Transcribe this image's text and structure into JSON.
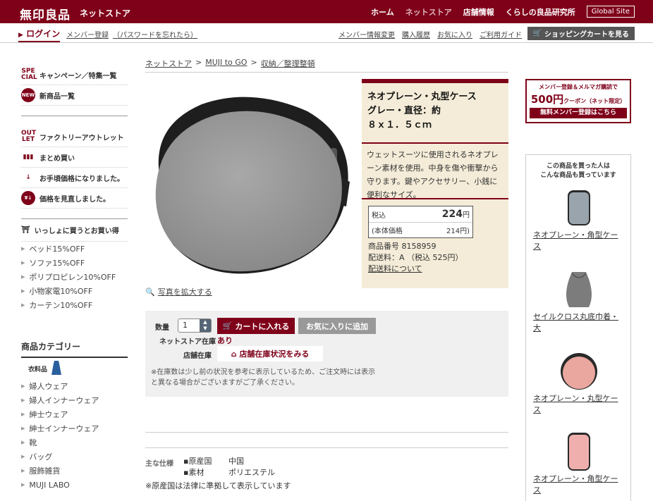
{
  "header": {
    "brand": "無印良品",
    "brand_sub": "ネットストア",
    "nav": [
      "ホーム",
      "ネットストア",
      "店舗情報",
      "くらしの良品研究所"
    ],
    "global": "Global Site"
  },
  "subbar": {
    "login": "ログイン",
    "left_links": [
      "メンバー登録",
      "（パスワードを忘れたら）"
    ],
    "right_links": [
      "メンバー情報変更",
      "購入履歴",
      "お気に入り",
      "ご利用ガイド"
    ],
    "cart": "ショッピングカートを見る"
  },
  "sidebar": {
    "special": {
      "icon": "SPE CIAL",
      "label": "キャンペーン／特集一覧"
    },
    "new_items": {
      "icon": "NEW",
      "label": "新商品一覧"
    },
    "outlet": {
      "icon": "OUT LET",
      "label": "ファクトリーアウトレット"
    },
    "bulk": "まとめ買い",
    "affordable": "お手頃価格になりました。",
    "price_review": "価格を見直しました。",
    "together": "いっしょに買うとお買い得",
    "together_items": [
      "ベッド15%OFF",
      "ソファ15%OFF",
      "ポリプロピレン10%OFF",
      "小物家電10%OFF",
      "カーテン10%OFF"
    ],
    "category_title": "商品カテゴリー",
    "clothing": "衣料品",
    "categories": [
      "婦人ウェア",
      "婦人インナーウェア",
      "紳士ウェア",
      "紳士インナーウェア",
      "靴",
      "バッグ",
      "服飾雑貨",
      "MUJI LABO"
    ]
  },
  "breadcrumb": [
    "ネットストア",
    "MUJI to GO",
    "収納／整理整頓"
  ],
  "product": {
    "title_lines": [
      "ネオプレーン・丸型ケース",
      "グレー・直径：約",
      "８ｘ１．５ｃｍ"
    ],
    "description": "ウェットスーツに使用されるネオプレーン素材を使用。中身を傷や衝撃から守ります。鍵やアクセサリー、小銭に便利なサイズ。",
    "tax_label": "税込",
    "tax_price": "224",
    "yen": "円",
    "base_label": "(本体価格",
    "base_price": "214円)",
    "product_no": "商品番号 8158959",
    "shipping": "配送料：A （税込 525円）",
    "shipping_link": "配送料について",
    "enlarge": "写真を拡大する"
  },
  "cart": {
    "qty_label": "数量",
    "qty_value": "1",
    "add_cart": "カートに入れる",
    "add_fav": "お気に入りに追加",
    "stock_label": "ネットストア在庫",
    "stock_value": "あり",
    "store_label": "店舗在庫",
    "store_btn": "店舗在庫状況をみる",
    "note": "※在庫数は少し前の状況を参考に表示しているため、ご注文時には表示と異なる場合がございますがご了承ください。"
  },
  "spec": {
    "label": "主な仕様",
    "rows": [
      {
        "k": "▪原産国",
        "v": "中国"
      },
      {
        "k": "▪素材",
        "v": "ポリエステル"
      }
    ],
    "note": "※原産国は法律に準拠して表示しています"
  },
  "promo": {
    "line1": "メンバー登録＆メルマガ購読で",
    "amount": "500円",
    "coupon": "クーポン（ネット限定）",
    "button": "無料メンバー登録はこちら"
  },
  "recommend": {
    "title_1": "この商品を買った人は",
    "title_2": "こんな商品も買っています",
    "items": [
      {
        "name": "ネオプレーン・角型ケース"
      },
      {
        "name": "セイルクロス丸底巾着・大"
      },
      {
        "name": "ネオプレーン・丸型ケース"
      },
      {
        "name": "ネオプレーン・角型ケース"
      }
    ]
  },
  "colors": {
    "brand": "#7f0019",
    "panel": "#f4ecd8"
  }
}
